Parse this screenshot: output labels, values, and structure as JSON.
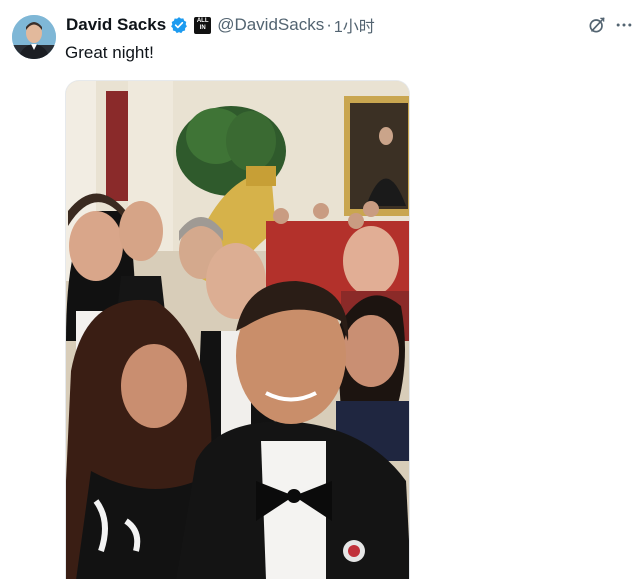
{
  "tweet": {
    "author": {
      "display_name": "David Sacks",
      "handle": "@DavidSacks",
      "verified": true,
      "affiliate_badge": "ALL IN",
      "avatar_icon": "profile-avatar"
    },
    "timestamp": "1小时",
    "separator": "·",
    "text": "Great night!",
    "media": {
      "type": "photo",
      "icon": "selfie-photo"
    },
    "actions": {
      "grok_icon": "grok-icon",
      "more_icon": "more-icon"
    }
  },
  "colors": {
    "verified_blue": "#1d9bf0",
    "secondary_text": "#536471",
    "primary_text": "#0f1419"
  }
}
